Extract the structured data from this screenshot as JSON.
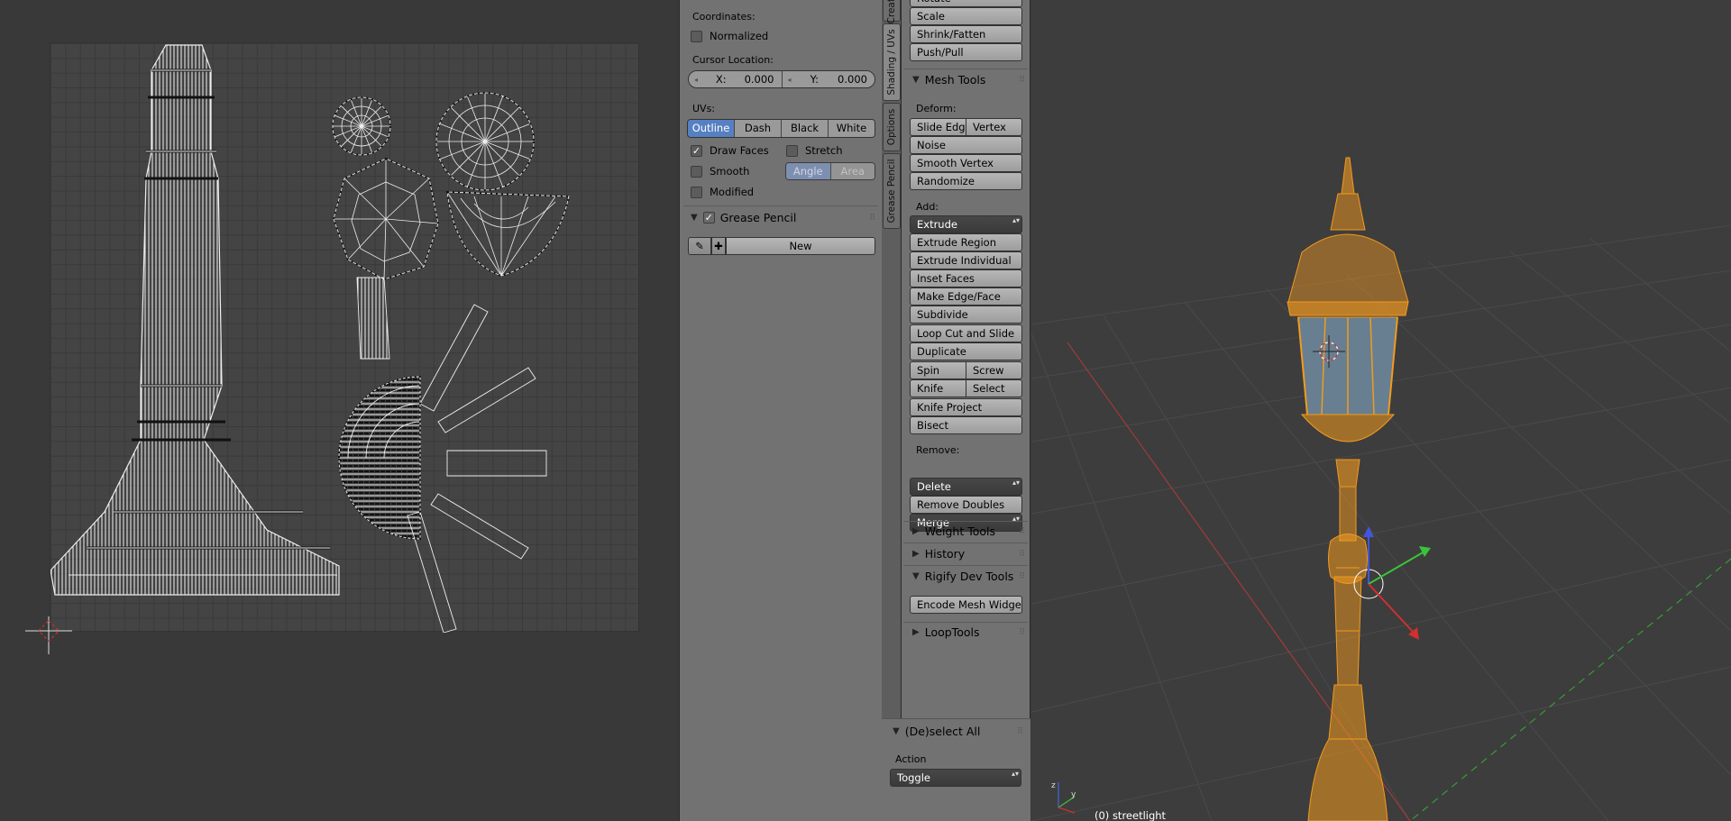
{
  "uv_panel": {
    "coordinates_label": "Coordinates:",
    "normalized_label": "Normalized",
    "cursor_label": "Cursor Location:",
    "cursor_x_label": "X:",
    "cursor_x_value": "0.000",
    "cursor_y_label": "Y:",
    "cursor_y_value": "0.000",
    "uvs_label": "UVs:",
    "draw_modes": [
      "Outline",
      "Dash",
      "Black",
      "White"
    ],
    "draw_faces_label": "Draw Faces",
    "stretch_label": "Stretch",
    "smooth_label": "Smooth",
    "angle_label": "Angle",
    "area_label": "Area",
    "modified_label": "Modified",
    "grease_pencil_label": "Grease Pencil",
    "new_label": "New"
  },
  "tabs": {
    "create": "Create",
    "shading_uvs": "Shading / UVs",
    "options": "Options",
    "grease_pencil": "Grease Pencil"
  },
  "toolshelf": {
    "rotate": "Rotate",
    "scale": "Scale",
    "shrink_fatten": "Shrink/Fatten",
    "push_pull": "Push/Pull",
    "mesh_tools_header": "Mesh Tools",
    "deform_label": "Deform:",
    "slide_edge": "Slide Edg",
    "vertex": "Vertex",
    "noise": "Noise",
    "smooth_vertex": "Smooth Vertex",
    "randomize": "Randomize",
    "add_label": "Add:",
    "extrude": "Extrude",
    "extrude_region": "Extrude Region",
    "extrude_individual": "Extrude Individual",
    "inset_faces": "Inset Faces",
    "make_edge_face": "Make Edge/Face",
    "subdivide": "Subdivide",
    "loop_cut_slide": "Loop Cut and Slide",
    "duplicate": "Duplicate",
    "spin": "Spin",
    "screw": "Screw",
    "knife": "Knife",
    "select": "Select",
    "knife_project": "Knife Project",
    "bisect": "Bisect",
    "remove_label": "Remove:",
    "delete": "Delete",
    "merge": "Merge",
    "remove_doubles": "Remove Doubles",
    "weight_tools": "Weight Tools",
    "history": "History",
    "rigify_dev_tools": "Rigify Dev Tools",
    "encode_mesh_widget": "Encode Mesh Widge...",
    "loop_tools": "LoopTools"
  },
  "redo_panel": {
    "header": "(De)select All",
    "action_label": "Action",
    "action_value": "Toggle"
  },
  "viewport": {
    "object_info": "(0) streetlight"
  },
  "colors": {
    "selection_orange": "#f39a1e",
    "active_blue": "#5680c2",
    "panel_gray": "#727272",
    "viewport_bg": "#3d3d3d"
  }
}
